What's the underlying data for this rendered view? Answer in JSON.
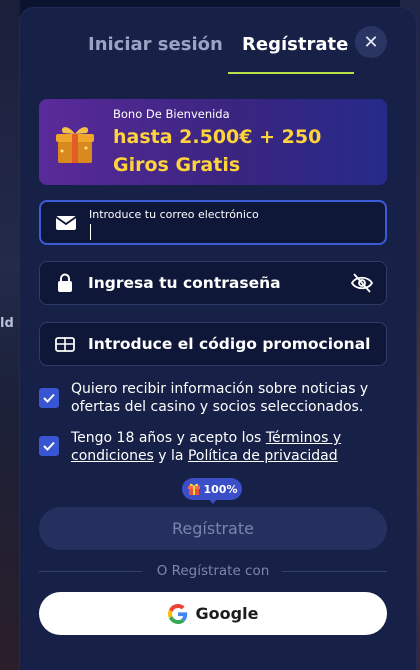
{
  "tabs": {
    "login": "Iniciar sesión",
    "register": "Regístrate"
  },
  "close_label": "✕",
  "background": {
    "left_text": "ld"
  },
  "banner": {
    "label": "Bono De Bienvenida",
    "offer": "hasta 2.500€ + 250 Giros Gratis"
  },
  "fields": {
    "email_label": "Introduce tu correo electrónico",
    "password_placeholder": "Ingresa tu contraseña",
    "promo_placeholder": "Introduce el código promocional"
  },
  "checks": {
    "marketing": "Quiero recibir información sobre noticias y ofertas del casino y socios seleccionados.",
    "terms_prefix": "Tengo 18 años y acepto los ",
    "terms_link": "Términos y condiciones",
    "terms_middle": " y la ",
    "privacy_link": "Política de privacidad"
  },
  "badge": {
    "value": "100%"
  },
  "submit_label": "Regístrate",
  "divider_text": "O Regístrate con",
  "google_label": "Google",
  "colors": {
    "accent_green": "#b8e046",
    "offer_yellow": "#ffd43b",
    "primary_blue": "#3a55d4",
    "modal_bg": "#172046"
  }
}
